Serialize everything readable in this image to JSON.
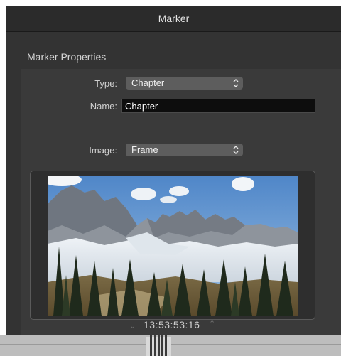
{
  "window": {
    "title": "Marker"
  },
  "section": {
    "header": "Marker Properties"
  },
  "form": {
    "type_label": "Type:",
    "type_value": "Chapter",
    "name_label": "Name:",
    "name_value": "Chapter",
    "image_label": "Image:",
    "image_value": "Frame"
  },
  "preview": {
    "timecode": "13:53:53:16"
  },
  "icons": {
    "popup_chevron": "up-down-chevron-icon",
    "prev": "chevron-down-icon",
    "next": "chevron-up-icon"
  },
  "colors": {
    "background": "#333333",
    "field": "#0d0d0d",
    "popup": "#5d5d5d"
  }
}
